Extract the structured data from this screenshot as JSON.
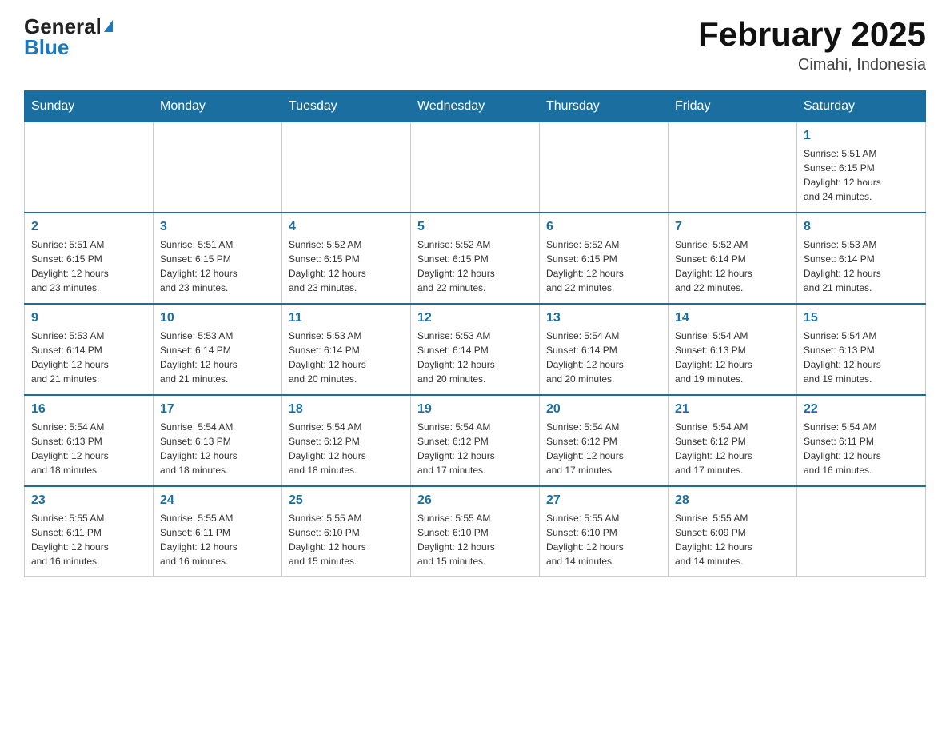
{
  "header": {
    "logo_general": "General",
    "logo_blue": "Blue",
    "month_title": "February 2025",
    "location": "Cimahi, Indonesia"
  },
  "weekdays": [
    "Sunday",
    "Monday",
    "Tuesday",
    "Wednesday",
    "Thursday",
    "Friday",
    "Saturday"
  ],
  "weeks": [
    [
      {
        "day": "",
        "info": ""
      },
      {
        "day": "",
        "info": ""
      },
      {
        "day": "",
        "info": ""
      },
      {
        "day": "",
        "info": ""
      },
      {
        "day": "",
        "info": ""
      },
      {
        "day": "",
        "info": ""
      },
      {
        "day": "1",
        "info": "Sunrise: 5:51 AM\nSunset: 6:15 PM\nDaylight: 12 hours\nand 24 minutes."
      }
    ],
    [
      {
        "day": "2",
        "info": "Sunrise: 5:51 AM\nSunset: 6:15 PM\nDaylight: 12 hours\nand 23 minutes."
      },
      {
        "day": "3",
        "info": "Sunrise: 5:51 AM\nSunset: 6:15 PM\nDaylight: 12 hours\nand 23 minutes."
      },
      {
        "day": "4",
        "info": "Sunrise: 5:52 AM\nSunset: 6:15 PM\nDaylight: 12 hours\nand 23 minutes."
      },
      {
        "day": "5",
        "info": "Sunrise: 5:52 AM\nSunset: 6:15 PM\nDaylight: 12 hours\nand 22 minutes."
      },
      {
        "day": "6",
        "info": "Sunrise: 5:52 AM\nSunset: 6:15 PM\nDaylight: 12 hours\nand 22 minutes."
      },
      {
        "day": "7",
        "info": "Sunrise: 5:52 AM\nSunset: 6:14 PM\nDaylight: 12 hours\nand 22 minutes."
      },
      {
        "day": "8",
        "info": "Sunrise: 5:53 AM\nSunset: 6:14 PM\nDaylight: 12 hours\nand 21 minutes."
      }
    ],
    [
      {
        "day": "9",
        "info": "Sunrise: 5:53 AM\nSunset: 6:14 PM\nDaylight: 12 hours\nand 21 minutes."
      },
      {
        "day": "10",
        "info": "Sunrise: 5:53 AM\nSunset: 6:14 PM\nDaylight: 12 hours\nand 21 minutes."
      },
      {
        "day": "11",
        "info": "Sunrise: 5:53 AM\nSunset: 6:14 PM\nDaylight: 12 hours\nand 20 minutes."
      },
      {
        "day": "12",
        "info": "Sunrise: 5:53 AM\nSunset: 6:14 PM\nDaylight: 12 hours\nand 20 minutes."
      },
      {
        "day": "13",
        "info": "Sunrise: 5:54 AM\nSunset: 6:14 PM\nDaylight: 12 hours\nand 20 minutes."
      },
      {
        "day": "14",
        "info": "Sunrise: 5:54 AM\nSunset: 6:13 PM\nDaylight: 12 hours\nand 19 minutes."
      },
      {
        "day": "15",
        "info": "Sunrise: 5:54 AM\nSunset: 6:13 PM\nDaylight: 12 hours\nand 19 minutes."
      }
    ],
    [
      {
        "day": "16",
        "info": "Sunrise: 5:54 AM\nSunset: 6:13 PM\nDaylight: 12 hours\nand 18 minutes."
      },
      {
        "day": "17",
        "info": "Sunrise: 5:54 AM\nSunset: 6:13 PM\nDaylight: 12 hours\nand 18 minutes."
      },
      {
        "day": "18",
        "info": "Sunrise: 5:54 AM\nSunset: 6:12 PM\nDaylight: 12 hours\nand 18 minutes."
      },
      {
        "day": "19",
        "info": "Sunrise: 5:54 AM\nSunset: 6:12 PM\nDaylight: 12 hours\nand 17 minutes."
      },
      {
        "day": "20",
        "info": "Sunrise: 5:54 AM\nSunset: 6:12 PM\nDaylight: 12 hours\nand 17 minutes."
      },
      {
        "day": "21",
        "info": "Sunrise: 5:54 AM\nSunset: 6:12 PM\nDaylight: 12 hours\nand 17 minutes."
      },
      {
        "day": "22",
        "info": "Sunrise: 5:54 AM\nSunset: 6:11 PM\nDaylight: 12 hours\nand 16 minutes."
      }
    ],
    [
      {
        "day": "23",
        "info": "Sunrise: 5:55 AM\nSunset: 6:11 PM\nDaylight: 12 hours\nand 16 minutes."
      },
      {
        "day": "24",
        "info": "Sunrise: 5:55 AM\nSunset: 6:11 PM\nDaylight: 12 hours\nand 16 minutes."
      },
      {
        "day": "25",
        "info": "Sunrise: 5:55 AM\nSunset: 6:10 PM\nDaylight: 12 hours\nand 15 minutes."
      },
      {
        "day": "26",
        "info": "Sunrise: 5:55 AM\nSunset: 6:10 PM\nDaylight: 12 hours\nand 15 minutes."
      },
      {
        "day": "27",
        "info": "Sunrise: 5:55 AM\nSunset: 6:10 PM\nDaylight: 12 hours\nand 14 minutes."
      },
      {
        "day": "28",
        "info": "Sunrise: 5:55 AM\nSunset: 6:09 PM\nDaylight: 12 hours\nand 14 minutes."
      },
      {
        "day": "",
        "info": ""
      }
    ]
  ]
}
